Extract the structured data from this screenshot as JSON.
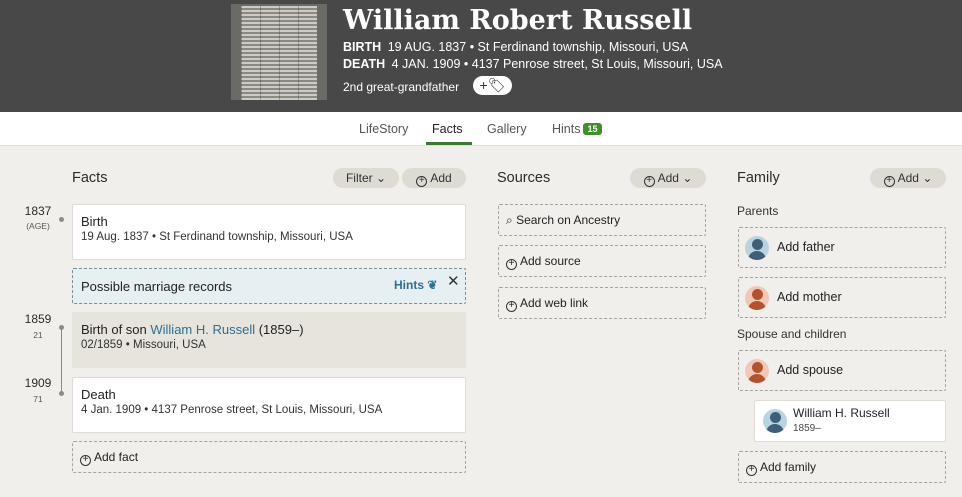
{
  "header": {
    "name": "William Robert Russell",
    "birth_label": "BIRTH",
    "birth_value": "19 AUG. 1837 • St Ferdinand township, Missouri, USA",
    "death_label": "DEATH",
    "death_value": "4 JAN. 1909 • 4137 Penrose street, St Louis, Missouri, USA",
    "relation": "2nd great-grandfather",
    "tag_button": "+🏷"
  },
  "tabs": [
    {
      "label": "LifeStory"
    },
    {
      "label": "Facts",
      "active": true
    },
    {
      "label": "Gallery"
    },
    {
      "label": "Hints",
      "badge": "15"
    }
  ],
  "facts": {
    "title": "Facts",
    "filter_label": "Filter",
    "add_label": "Add",
    "timeline": [
      {
        "year": "1837",
        "age": "(AGE)"
      },
      {
        "year": "1859",
        "age": "21"
      },
      {
        "year": "1909",
        "age": "71"
      }
    ],
    "birth": {
      "title": "Birth",
      "detail": "19 Aug. 1837 • St Ferdinand township, Missouri, USA"
    },
    "hint": {
      "title": "Possible marriage records",
      "link": "Hints"
    },
    "son": {
      "title_prefix": "Birth of son ",
      "name": "William H. Russell",
      "years": " (1859–)",
      "detail": "02/1859 • Missouri, USA"
    },
    "death": {
      "title": "Death",
      "detail": "4 Jan. 1909 • 4137 Penrose street, St Louis, Missouri, USA"
    },
    "add_fact": "Add fact"
  },
  "sources": {
    "title": "Sources",
    "add_label": "Add",
    "search": "Search on Ancestry",
    "add_source": "Add source",
    "add_web_link": "Add web link"
  },
  "family": {
    "title": "Family",
    "add_label": "Add",
    "parents_label": "Parents",
    "add_father": "Add father",
    "add_mother": "Add mother",
    "spouse_label": "Spouse and children",
    "add_spouse": "Add spouse",
    "child_name": "William H. Russell",
    "child_years": "1859–",
    "add_family": "Add family"
  },
  "colors": {
    "header_bg": "#484848",
    "accent_green": "#3a7b33",
    "link_blue": "#2f6f8f",
    "page_bg": "#f1efeb"
  }
}
